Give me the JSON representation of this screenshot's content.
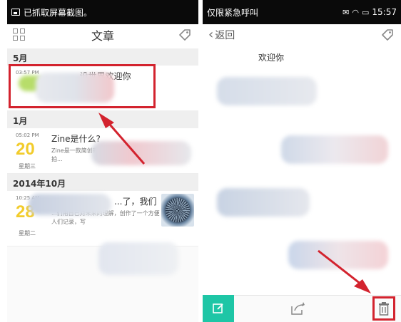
{
  "left": {
    "statusbar": {
      "text": "已抓取屏幕截图。",
      "icon": "screenshot-icon"
    },
    "toolbar": {
      "title": "文章",
      "menu_icon": "grid-icon",
      "tag_icon": "tag-icon"
    },
    "sections": [
      {
        "month": "5月",
        "entries": [
          {
            "time": "03:57 PM",
            "day": "",
            "weekday": "",
            "title": "...设世界欢迎你",
            "snippet": ""
          }
        ]
      },
      {
        "month": "1月",
        "entries": [
          {
            "time": "05:02 PM",
            "day": "20",
            "weekday": "星期三",
            "title": "Zine是什么?",
            "snippet": "Zine是一款简创新的...机上记录文字，拍..."
          }
        ]
      },
      {
        "month": "2014年10月",
        "entries": [
          {
            "time": "10:25 AM",
            "day": "28",
            "weekday": "星期二",
            "title": "...了，我们",
            "snippet": "...们用自己对未来的理解，创作了一个方便人们记录，写"
          }
        ]
      }
    ],
    "colors": {
      "day_yellow": "#f2cc2c",
      "day_green": "#a7cc36",
      "highlight": "#d3232e"
    }
  },
  "right": {
    "statusbar": {
      "text": "仅限紧急呼叫",
      "time": "15:57"
    },
    "toolbar": {
      "back_label": "返回",
      "tag_icon": "tag-icon"
    },
    "content_text": "欢迎你",
    "bottombar": {
      "edit_icon": "edit-icon",
      "share_icon": "share-icon",
      "delete_icon": "trash-icon"
    },
    "colors": {
      "accent": "#1ec6a6"
    }
  }
}
